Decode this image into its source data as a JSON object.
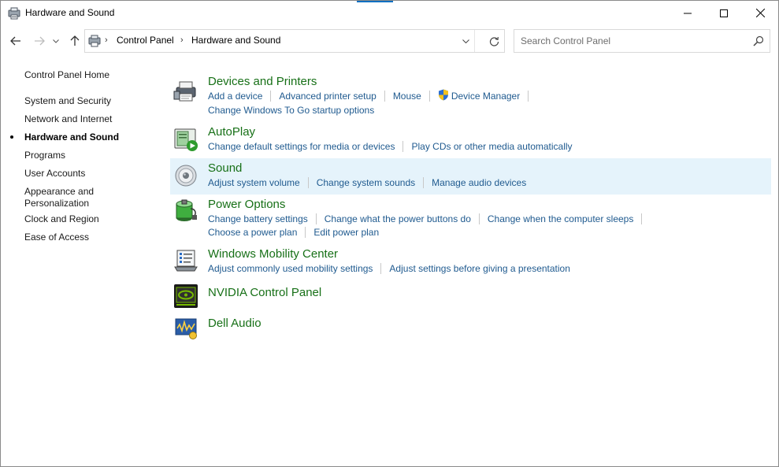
{
  "window": {
    "title": "Hardware and Sound"
  },
  "nav": {
    "breadcrumb": [
      "Control Panel",
      "Hardware and Sound"
    ],
    "search_placeholder": "Search Control Panel"
  },
  "sidebar": {
    "home": "Control Panel Home",
    "items": [
      {
        "label": "System and Security"
      },
      {
        "label": "Network and Internet"
      },
      {
        "label": "Hardware and Sound",
        "active": true
      },
      {
        "label": "Programs"
      },
      {
        "label": "User Accounts"
      },
      {
        "label": "Appearance and Personalization",
        "line1": "Appearance and",
        "line2": "Personalization"
      },
      {
        "label": "Clock and Region"
      },
      {
        "label": "Ease of Access"
      }
    ]
  },
  "categories": [
    {
      "title": "Devices and Printers",
      "icon": "printer-icon",
      "links": [
        "Add a device",
        "Advanced printer setup",
        "Mouse",
        "Device Manager",
        "Change Windows To Go startup options"
      ]
    },
    {
      "title": "AutoPlay",
      "icon": "autoplay-icon",
      "links": [
        "Change default settings for media or devices",
        "Play CDs or other media automatically"
      ]
    },
    {
      "title": "Sound",
      "icon": "speaker-icon",
      "links": [
        "Adjust system volume",
        "Change system sounds",
        "Manage audio devices"
      ]
    },
    {
      "title": "Power Options",
      "icon": "battery-icon",
      "links": [
        "Change battery settings",
        "Change what the power buttons do",
        "Change when the computer sleeps",
        "Choose a power plan",
        "Edit power plan"
      ]
    },
    {
      "title": "Windows Mobility Center",
      "icon": "mobility-center-icon",
      "links": [
        "Adjust commonly used mobility settings",
        "Adjust settings before giving a presentation"
      ]
    },
    {
      "title": "NVIDIA Control Panel",
      "icon": "nvidia-icon",
      "links": []
    },
    {
      "title": "Dell Audio",
      "icon": "dell-audio-icon",
      "links": []
    }
  ],
  "colors": {
    "link": "#1f5a8f",
    "category_title": "#177017",
    "highlight": "#e5f3fb",
    "accent": "#0a6fc2"
  }
}
